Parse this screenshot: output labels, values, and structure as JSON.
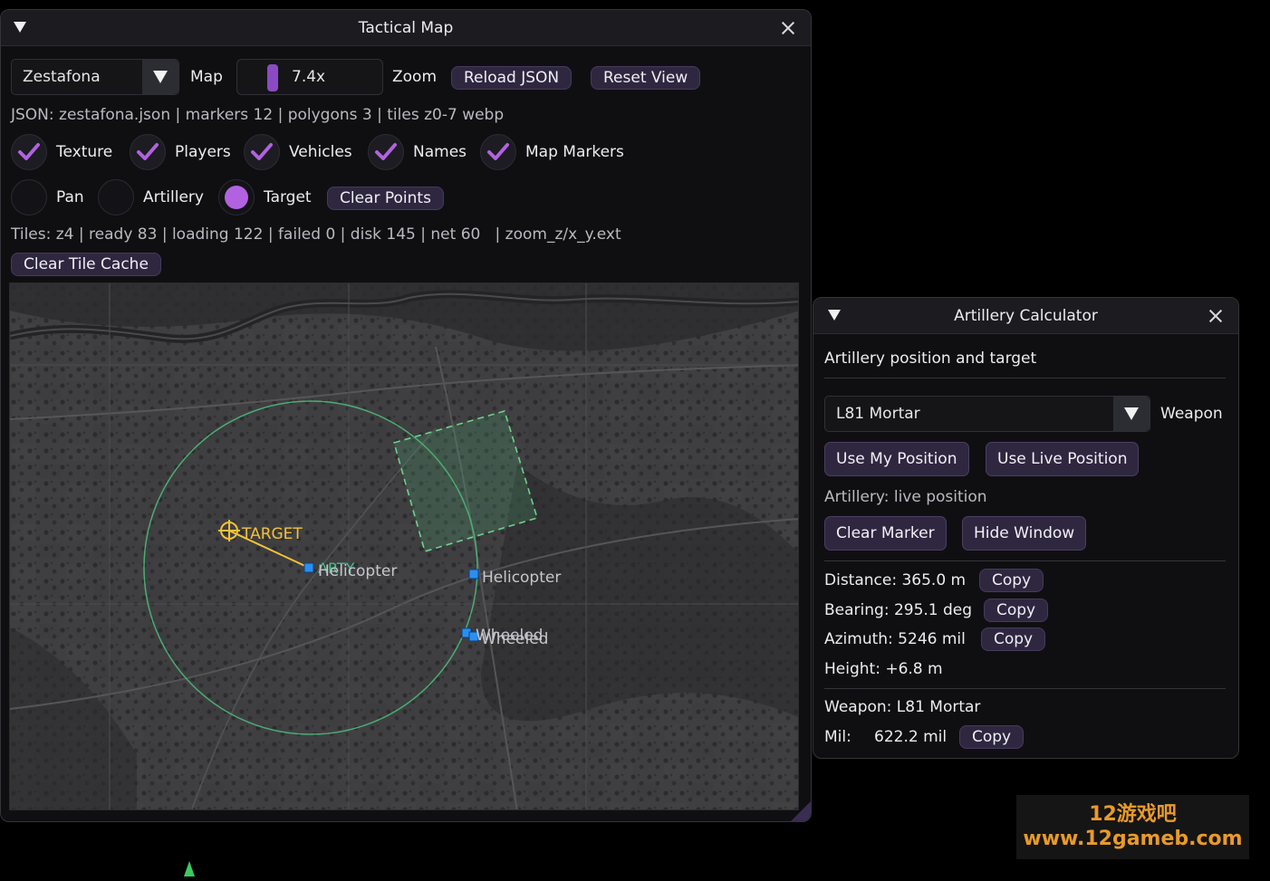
{
  "tactical": {
    "title": "Tactical Map",
    "map_select": "Zestafona",
    "map_label": "Map",
    "zoom_value": "7.4x",
    "zoom_label": "Zoom",
    "reload_label": "Reload JSON",
    "reset_label": "Reset View",
    "json_info": "JSON: zestafona.json | markers 12 | polygons 3 | tiles z0-7 webp",
    "checks": [
      {
        "label": "Texture",
        "checked": true
      },
      {
        "label": "Players",
        "checked": true
      },
      {
        "label": "Vehicles",
        "checked": true
      },
      {
        "label": "Names",
        "checked": true
      },
      {
        "label": "Map Markers",
        "checked": true
      }
    ],
    "modes": [
      {
        "label": "Pan",
        "selected": false
      },
      {
        "label": "Artillery",
        "selected": false
      },
      {
        "label": "Target",
        "selected": true
      }
    ],
    "clear_points_label": "Clear Points",
    "tiles_info": "Tiles: z4 | ready 83 | loading 122 | failed 0 | disk 145 | net 60   | zoom_z/x_y.ext",
    "clear_cache_label": "Clear Tile Cache",
    "map_labels": {
      "target": "TARGET",
      "arty": "ARTY",
      "helicopter_1": "Helicopter",
      "helicopter_2": "Helicopter",
      "wheeled_1": "Wheeled",
      "wheeled_2": "Wheeled"
    }
  },
  "artillery": {
    "title": "Artillery Calculator",
    "section_title": "Artillery position and target",
    "weapon_select": "L81 Mortar",
    "weapon_label": "Weapon",
    "use_my_position": "Use My Position",
    "use_live_position": "Use Live Position",
    "status": "Artillery: live position",
    "clear_marker": "Clear Marker",
    "hide_window": "Hide Window",
    "distance": "Distance: 365.0 m",
    "bearing": "Bearing: 295.1 deg",
    "azimuth": "Azimuth: 5246 mil",
    "height": "Height: +6.8 m",
    "copy_label": "Copy",
    "weapon_line": "Weapon: L81 Mortar",
    "mil_label": "Mil:",
    "mil_value": "622.2 mil"
  },
  "watermark": {
    "line1": "12游戏吧",
    "line2": "www.12gameb.com"
  },
  "colors": {
    "accent": "#b262e0",
    "button_bg": "#2f2740",
    "marker_blue": "#2a8ff0",
    "target_yellow": "#f2c23a",
    "range_green": "#4fbf7f"
  }
}
